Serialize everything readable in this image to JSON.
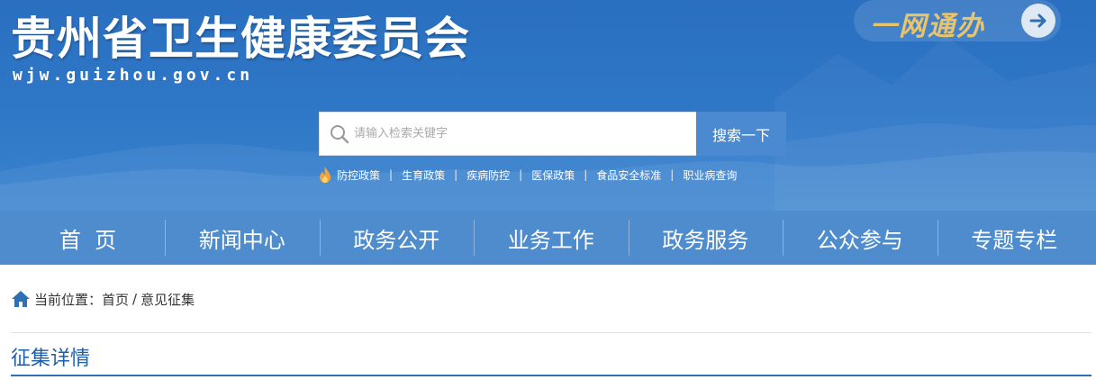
{
  "header": {
    "site_title": "贵州省卫生健康委员会",
    "site_domain": "wjw.guizhou.gov.cn",
    "service_badge": "一网通办",
    "service_arrow_icon": "arrow-right-icon"
  },
  "search": {
    "placeholder": "请输入检索关键字",
    "value": "",
    "button_label": "搜索一下",
    "icon": "search-icon"
  },
  "hot_links": {
    "icon": "flame-icon",
    "items": [
      "防控政策",
      "生育政策",
      "疾病防控",
      "医保政策",
      "食品安全标准",
      "职业病查询"
    ],
    "separator": "|"
  },
  "nav": {
    "items": [
      "首  页",
      "新闻中心",
      "政务公开",
      "业务工作",
      "政务服务",
      "公众参与",
      "专题专栏"
    ]
  },
  "breadcrumb": {
    "icon": "home-icon",
    "prefix": "当前位置：",
    "home": "首页",
    "separator": "/",
    "current": "意见征集"
  },
  "section": {
    "title": "征集详情"
  },
  "colors": {
    "header_bg": "#2f78c7",
    "nav_bg": "#4f8ccd",
    "search_button": "#4b8ad0",
    "badge_text": "#e8c46c",
    "section_title": "#1f5ea8"
  }
}
